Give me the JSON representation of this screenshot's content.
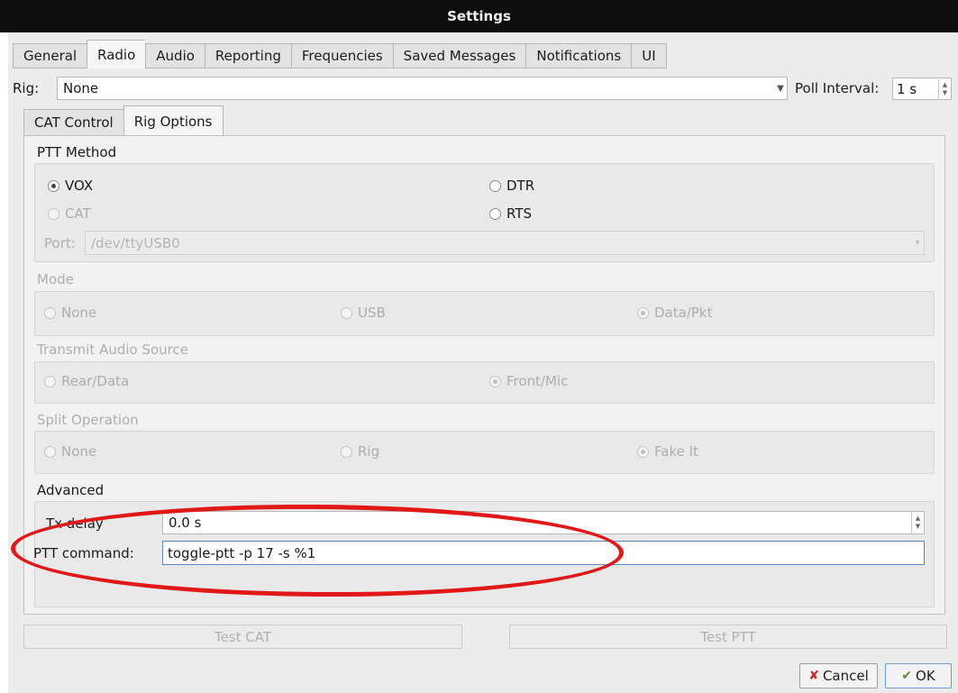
{
  "window": {
    "title": "Settings"
  },
  "tabs": [
    "General",
    "Radio",
    "Audio",
    "Reporting",
    "Frequencies",
    "Saved Messages",
    "Notifications",
    "UI"
  ],
  "rig": {
    "label": "Rig:",
    "value": "None",
    "poll_label": "Poll Interval:",
    "poll_value": "1 s"
  },
  "subtabs": [
    "CAT Control",
    "Rig Options"
  ],
  "ptt": {
    "title": "PTT Method",
    "vox": "VOX",
    "dtr": "DTR",
    "cat": "CAT",
    "rts": "RTS",
    "port_label": "Port:",
    "port_value": "/dev/ttyUSB0"
  },
  "mode": {
    "title": "Mode",
    "none": "None",
    "usb": "USB",
    "data": "Data/Pkt"
  },
  "tx_audio": {
    "title": "Transmit Audio Source",
    "rear": "Rear/Data",
    "front": "Front/Mic"
  },
  "split": {
    "title": "Split Operation",
    "none": "None",
    "rig": "Rig",
    "fake": "Fake It"
  },
  "advanced": {
    "title": "Advanced",
    "tx_delay_label": "Tx delay",
    "tx_delay_value": "0.0 s",
    "ptt_command_label": "PTT command:",
    "ptt_command_value": "toggle-ptt -p 17 -s %1"
  },
  "buttons": {
    "test_cat": "Test CAT",
    "test_ptt": "Test PTT",
    "cancel": "Cancel",
    "ok": "OK"
  },
  "colors": {
    "highlight_ellipse": "#e01818"
  }
}
